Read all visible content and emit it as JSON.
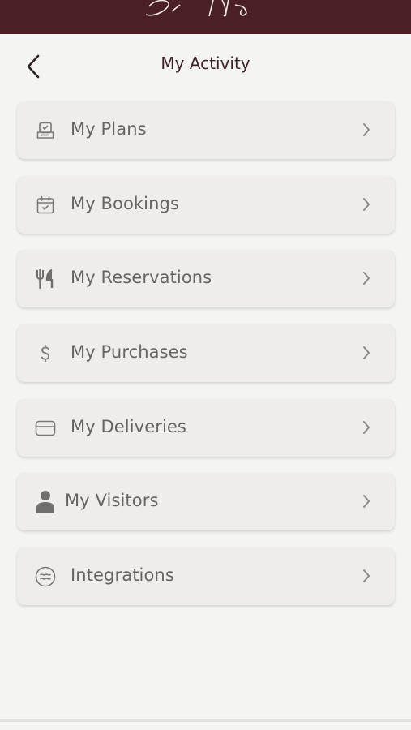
{
  "header": {
    "title": "My Activity"
  },
  "menu": [
    {
      "label": "My Plans",
      "icon": "plan-tray-icon"
    },
    {
      "label": "My Bookings",
      "icon": "calendar-check-icon"
    },
    {
      "label": "My Reservations",
      "icon": "fork-knife-icon"
    },
    {
      "label": "My Purchases",
      "icon": "dollar-icon"
    },
    {
      "label": "My Deliveries",
      "icon": "envelope-box-icon"
    },
    {
      "label": "My Visitors",
      "icon": "person-icon"
    },
    {
      "label": "Integrations",
      "icon": "integration-circle-icon"
    }
  ],
  "colors": {
    "brand": "#4a1f25",
    "background": "#f4f4f3",
    "card": "#eeedeb",
    "text": "#666564"
  }
}
